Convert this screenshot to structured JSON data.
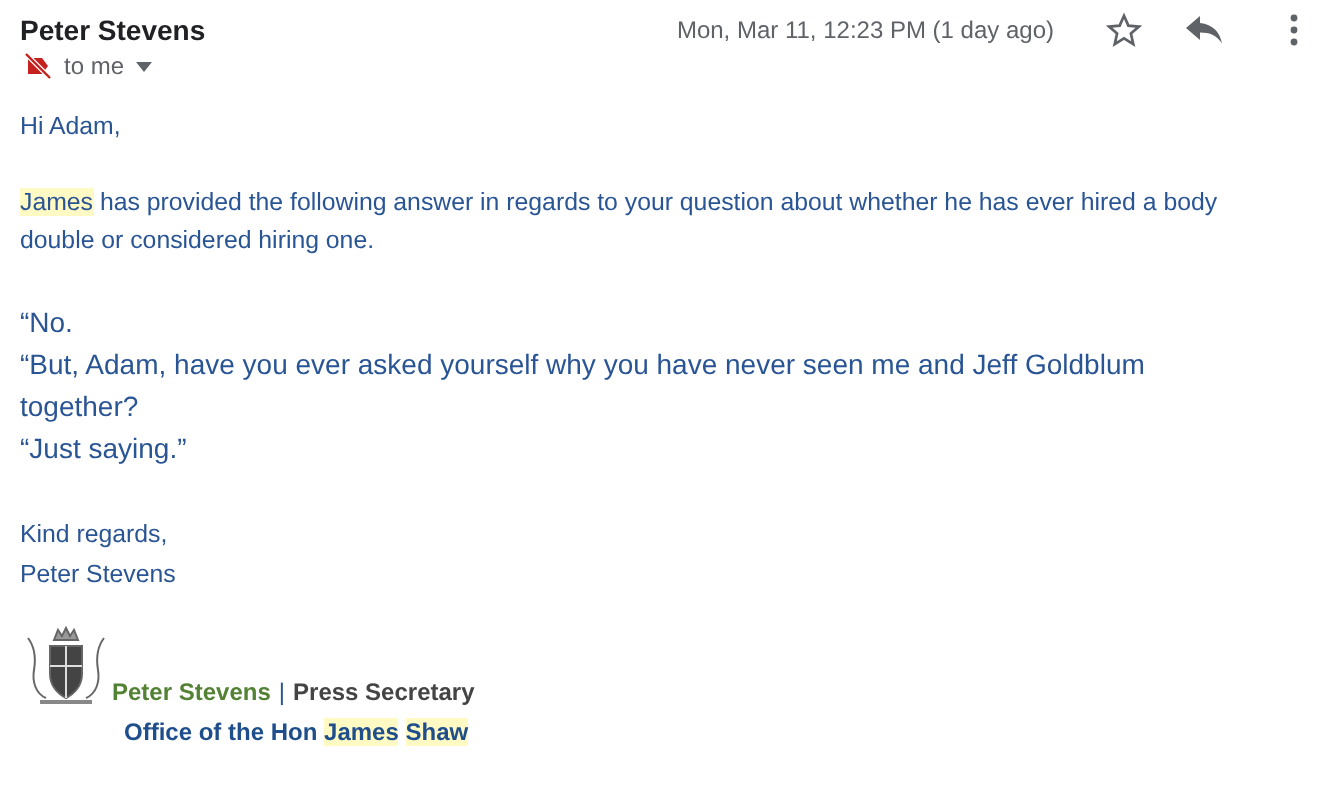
{
  "header": {
    "sender": "Peter Stevens",
    "recipient": "to me",
    "date": "Mon, Mar 11, 12:23 PM (1 day ago)",
    "starred": false
  },
  "body": {
    "greeting": "Hi Adam,",
    "intro": [
      {
        "text": "James",
        "highlighted": true
      },
      {
        "text": "has provided the following answer in regards to your question about whether he has ever hired a body double or considered hiring one.",
        "highlighted": false
      }
    ],
    "quote": [
      "“No.",
      "“But, Adam, have you ever asked yourself why you have never seen me and Jeff Goldblum together?",
      "“Just saying.”"
    ],
    "closing": [
      "Kind regards,",
      "Peter Stevens"
    ]
  },
  "signature": {
    "name": "Peter Stevens",
    "separator": "|",
    "role": "Press Secretary",
    "office": [
      {
        "text": "Office of the Hon",
        "highlighted": false
      },
      {
        "text": "James",
        "highlighted": true
      },
      {
        "text": "Shaw",
        "highlighted": true
      }
    ]
  }
}
